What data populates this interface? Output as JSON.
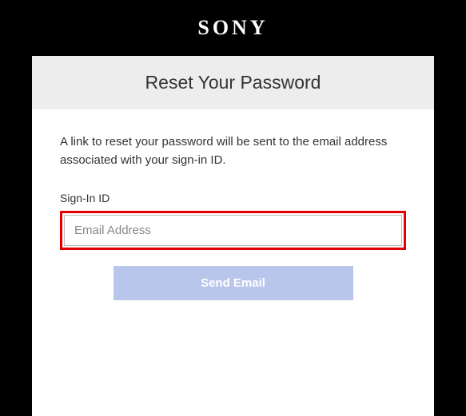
{
  "header": {
    "logo": "SONY"
  },
  "page": {
    "title": "Reset Your Password",
    "description": "A link to reset your password will be sent to the email address associated with your sign-in ID."
  },
  "form": {
    "signin_label": "Sign-In ID",
    "email_placeholder": "Email Address",
    "send_button": "Send Email"
  }
}
